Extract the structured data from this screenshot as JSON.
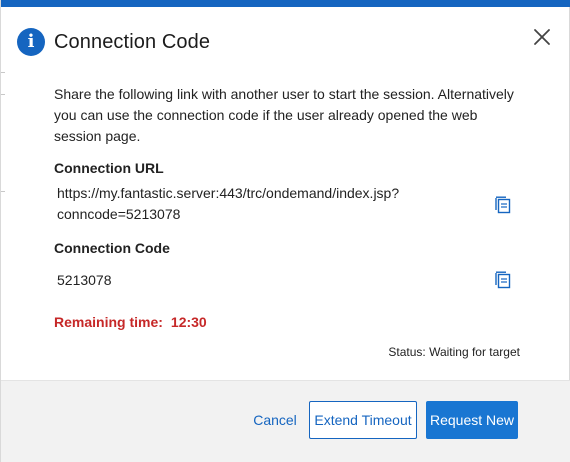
{
  "dialog": {
    "title": "Connection Code",
    "intro": "Share the following link with another user to start the session. Alternatively you can use the connection code if the user already opened the web session page.",
    "url_label": "Connection URL",
    "url_line1": "https://my.fantastic.server:443/trc/ondemand/index.jsp?",
    "url_line2": "conncode=5213078",
    "code_label": "Connection Code",
    "code_value": "5213078",
    "remaining_label": "Remaining time:",
    "remaining_value": "12:30",
    "status": "Status: Waiting for target"
  },
  "buttons": {
    "cancel": "Cancel",
    "extend": "Extend Timeout",
    "request": "Request New"
  },
  "icons": {
    "info": "info-icon",
    "close": "close-icon",
    "copy": "copy-icon"
  },
  "colors": {
    "accent": "#1565c0",
    "primary_button": "#1976d2",
    "warning_text": "#c62828",
    "footer_bg": "#f2f2f2"
  }
}
